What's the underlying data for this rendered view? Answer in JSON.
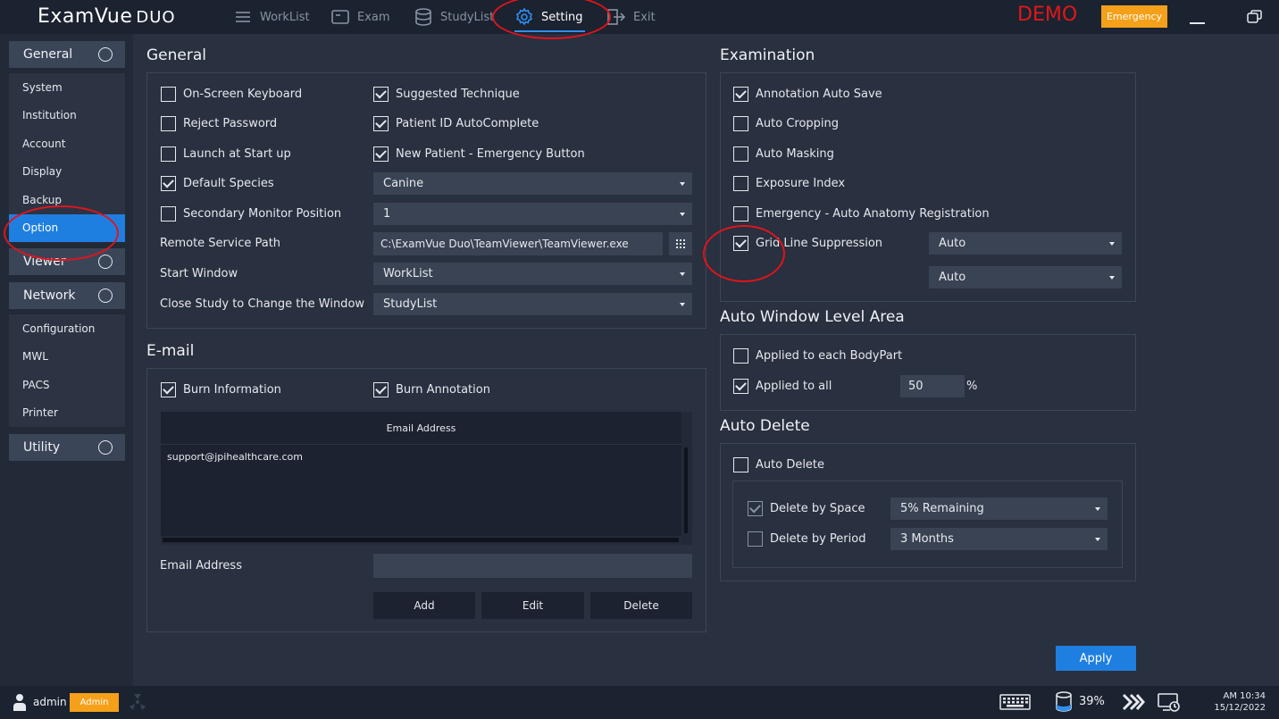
{
  "app": {
    "logo_main": "ExamVue",
    "logo_sub": "DUO",
    "demo_label": "DEMO",
    "emergency_label": "Emergency"
  },
  "nav": {
    "worklist": "WorkList",
    "exam": "Exam",
    "studylist": "StudyList",
    "setting": "Setting",
    "exit": "Exit"
  },
  "sidebar": {
    "general": "General",
    "general_items": [
      "System",
      "Institution",
      "Account",
      "Display",
      "Backup",
      "Option"
    ],
    "viewer": "Viewer",
    "network": "Network",
    "network_items": [
      "Configuration",
      "MWL",
      "PACS",
      "Printer"
    ],
    "utility": "Utility"
  },
  "general": {
    "title": "General",
    "on_screen_keyboard": "On-Screen Keyboard",
    "suggested_technique": "Suggested Technique",
    "reject_password": "Reject Password",
    "patient_id_autocomplete": "Patient ID AutoComplete",
    "launch_at_startup": "Launch at Start up",
    "new_patient_emergency": "New Patient - Emergency Button",
    "default_species": "Default Species",
    "default_species_value": "Canine",
    "secondary_monitor": "Secondary Monitor Position",
    "secondary_monitor_value": "1",
    "remote_service_path": "Remote Service Path",
    "remote_service_path_value": "C:\\ExamVue Duo\\TeamViewer\\TeamViewer.exe",
    "start_window": "Start Window",
    "start_window_value": "WorkList",
    "close_study": "Close Study to Change the Window",
    "close_study_value": "StudyList"
  },
  "email": {
    "title": "E-mail",
    "burn_information": "Burn Information",
    "burn_annotation": "Burn Annotation",
    "table_header": "Email Address",
    "rows": [
      "support@jpihealthcare.com"
    ],
    "address_label": "Email Address",
    "address_value": "",
    "add": "Add",
    "edit": "Edit",
    "delete": "Delete"
  },
  "examination": {
    "title": "Examination",
    "annotation_auto_save": "Annotation Auto Save",
    "auto_cropping": "Auto Cropping",
    "auto_masking": "Auto Masking",
    "exposure_index": "Exposure Index",
    "emergency_auto_anatomy": "Emergency - Auto Anatomy Registration",
    "grid_line_suppression": "Grid Line Suppression",
    "grid_select_1": "Auto",
    "grid_select_2": "Auto"
  },
  "auto_window": {
    "title": "Auto Window Level Area",
    "applied_each": "Applied to each BodyPart",
    "applied_all": "Applied to all",
    "applied_all_value": "50",
    "unit": "%"
  },
  "auto_delete": {
    "title": "Auto Delete",
    "auto_delete": "Auto Delete",
    "by_space": "Delete by Space",
    "by_space_value": "5% Remaining",
    "by_period": "Delete by Period",
    "by_period_value": "3 Months"
  },
  "apply_label": "Apply",
  "status": {
    "user": "admin",
    "role": "Admin",
    "disk": "39%",
    "time": "AM 10:34",
    "date": "15/12/2022"
  },
  "colors": {
    "accent": "#1f7fe0",
    "emergency": "#f5a01a",
    "demo": "#e01818",
    "annotation": "#e0141c"
  }
}
